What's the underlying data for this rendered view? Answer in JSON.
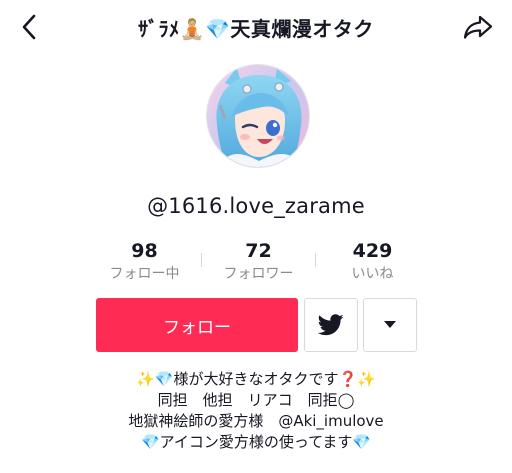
{
  "header": {
    "title": "ｻﾞﾗﾒ🧘🏼💎天真爛漫オタク",
    "back_icon": "chevron-left-icon",
    "share_icon": "share-arrow-icon"
  },
  "profile": {
    "username": "@1616.love_zarame",
    "avatar_icon": "avatar-illustration"
  },
  "stats": [
    {
      "value": "98",
      "label": "フォロー中"
    },
    {
      "value": "72",
      "label": "フォロワー"
    },
    {
      "value": "429",
      "label": "いいね"
    }
  ],
  "actions": {
    "follow_label": "フォロー",
    "twitter_icon": "twitter-bird-icon",
    "dropdown_icon": "caret-down-icon",
    "accent_color": "#fe2c55"
  },
  "bio": [
    "✨💎様が大好きなオタクです❓✨",
    "同担　他担　リアコ　同拒◯",
    "地獄神絵師の愛方様　@Aki_imulove",
    "💎アイコン愛方様の使ってます💎"
  ]
}
